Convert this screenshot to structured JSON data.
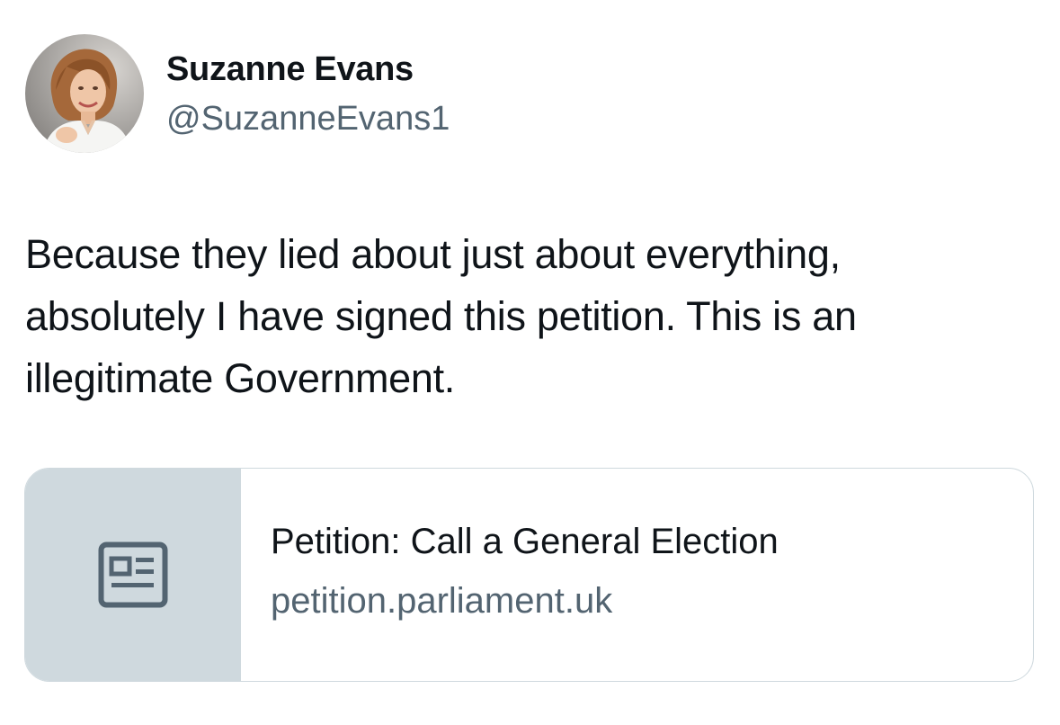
{
  "author": {
    "display_name": "Suzanne Evans",
    "handle": "@SuzanneEvans1"
  },
  "tweet": {
    "text": "Because they lied about just about everything,\nabsolutely I have signed this petition. This is an\nillegitimate Government."
  },
  "link_card": {
    "icon": "article-icon",
    "title": "Petition: Call a General Election",
    "domain": "petition.parliament.uk"
  },
  "colors": {
    "primary_text": "#0f1419",
    "secondary_text": "#536471",
    "card_border": "#cfd9de",
    "card_thumb_bg": "#cfd9de"
  }
}
